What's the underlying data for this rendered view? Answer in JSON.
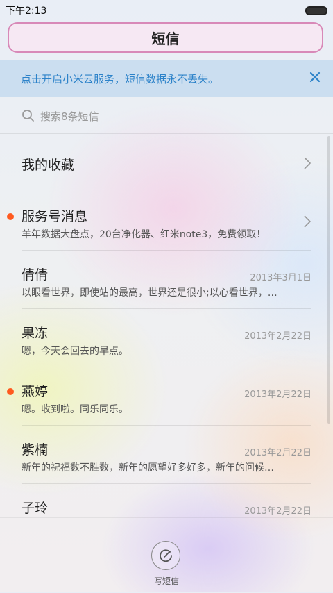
{
  "status_bar": {
    "time": "下午2:13"
  },
  "header": {
    "title": "短信"
  },
  "banner": {
    "text": "点击开启小米云服务，短信数据永不丢失。"
  },
  "search": {
    "placeholder": "搜索8条短信"
  },
  "messages": [
    {
      "title": "我的收藏",
      "preview": "",
      "date": "",
      "unread": false,
      "chevron": true
    },
    {
      "title": "服务号消息",
      "preview": "羊年数据大盘点，20台净化器、红米note3，免费领取！",
      "date": "",
      "unread": true,
      "chevron": true
    },
    {
      "title": "倩倩",
      "preview": "以眼看世界，即使站的最高，世界还是很小;以心看世界，…",
      "date": "2013年3月1日",
      "unread": false,
      "chevron": false
    },
    {
      "title": "果冻",
      "preview": "嗯，今天会回去的早点。",
      "date": "2013年2月22日",
      "unread": false,
      "chevron": false
    },
    {
      "title": "燕婷",
      "preview": "嗯。收到啦。同乐同乐。",
      "date": "2013年2月22日",
      "unread": true,
      "chevron": false
    },
    {
      "title": "紫楠",
      "preview": "新年的祝福数不胜数，新年的愿望好多好多，新年的问候…",
      "date": "2013年2月22日",
      "unread": false,
      "chevron": false
    },
    {
      "title": "子玲",
      "preview": "",
      "date": "2013年2月22日",
      "unread": false,
      "chevron": false
    }
  ],
  "bottom": {
    "compose_label": "写短信"
  },
  "colors": {
    "accent_blue": "#2c82c9",
    "unread_dot": "#ff5a1f",
    "title_border": "#d889b8"
  }
}
